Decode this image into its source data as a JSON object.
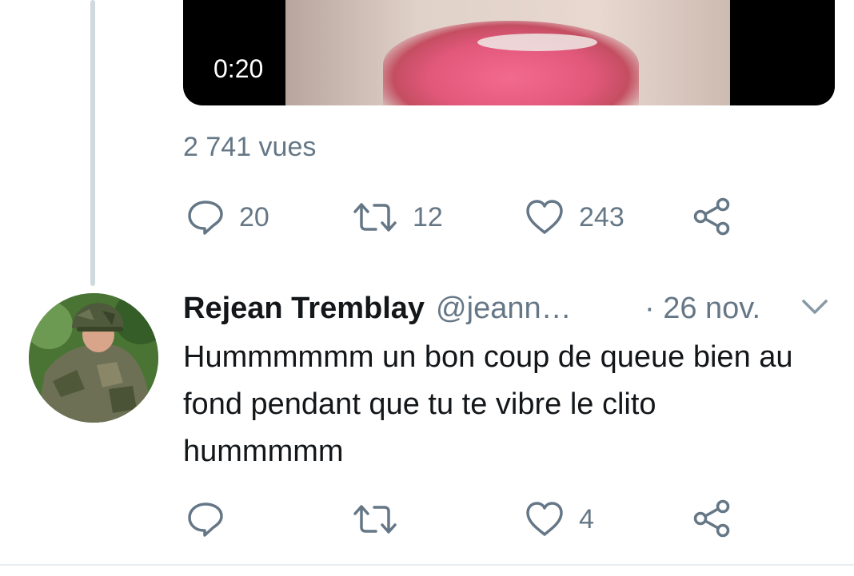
{
  "main_tweet": {
    "video_duration": "0:20",
    "views": "2 741 vues",
    "actions": {
      "reply_count": "20",
      "retweet_count": "12",
      "like_count": "243"
    }
  },
  "reply_tweet": {
    "author_name": "Rejean Tremblay",
    "handle": "@jeann…",
    "date": "· 26 nov.",
    "text": "Hummmmmm un bon coup de queue bien au fond pendant que tu te vibre le clito hummmmm",
    "actions": {
      "reply_count": "",
      "retweet_count": "",
      "like_count": "4"
    }
  },
  "colors": {
    "secondary_text": "#657786",
    "primary_text": "#14171a",
    "thread_line": "#cfd9de"
  },
  "icons": [
    "reply-icon",
    "retweet-icon",
    "like-icon",
    "share-icon",
    "chevron-down-icon"
  ]
}
